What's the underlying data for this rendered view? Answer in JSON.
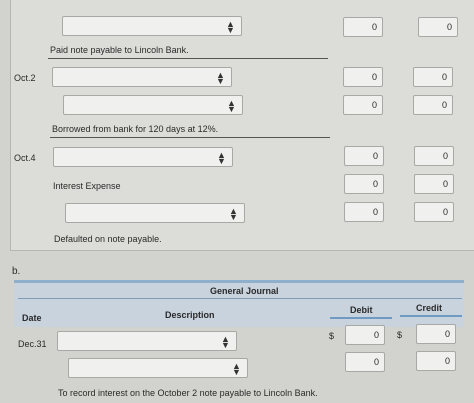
{
  "part_a": {
    "rows": [
      {
        "id": "r0",
        "date": "",
        "debit": "0",
        "credit": "0"
      },
      {
        "id": "r1",
        "date": "Oct.2",
        "debit": "0",
        "credit": "0"
      },
      {
        "id": "r2",
        "date": "",
        "debit": "0",
        "credit": "0"
      },
      {
        "id": "r3",
        "date": "Oct.4",
        "debit": "0",
        "credit": "0"
      },
      {
        "id": "r4",
        "date": "",
        "debit": "0",
        "credit": "0"
      },
      {
        "id": "r5",
        "date": "",
        "debit": "0",
        "credit": "0"
      }
    ],
    "notes": {
      "n1": "Paid note payable to Lincoln Bank.",
      "n2": "Borrowed from bank for 120 days at 12%.",
      "interest_label": "Interest Expense",
      "n3": "Defaulted on note payable."
    }
  },
  "part_b": {
    "label": "b.",
    "journal": {
      "title": "General Journal",
      "col_date": "Date",
      "col_description": "Description",
      "col_debit": "Debit",
      "col_credit": "Credit"
    },
    "rows": [
      {
        "date": "Dec.31",
        "debit_currency": "$",
        "debit": "0",
        "credit_currency": "$",
        "credit": "0"
      },
      {
        "date": "",
        "debit": "0",
        "credit": "0"
      }
    ],
    "note": "To record interest on the October 2 note payable to Lincoln Bank."
  },
  "icons": {
    "dropdown": "updown-chevron-icon"
  }
}
